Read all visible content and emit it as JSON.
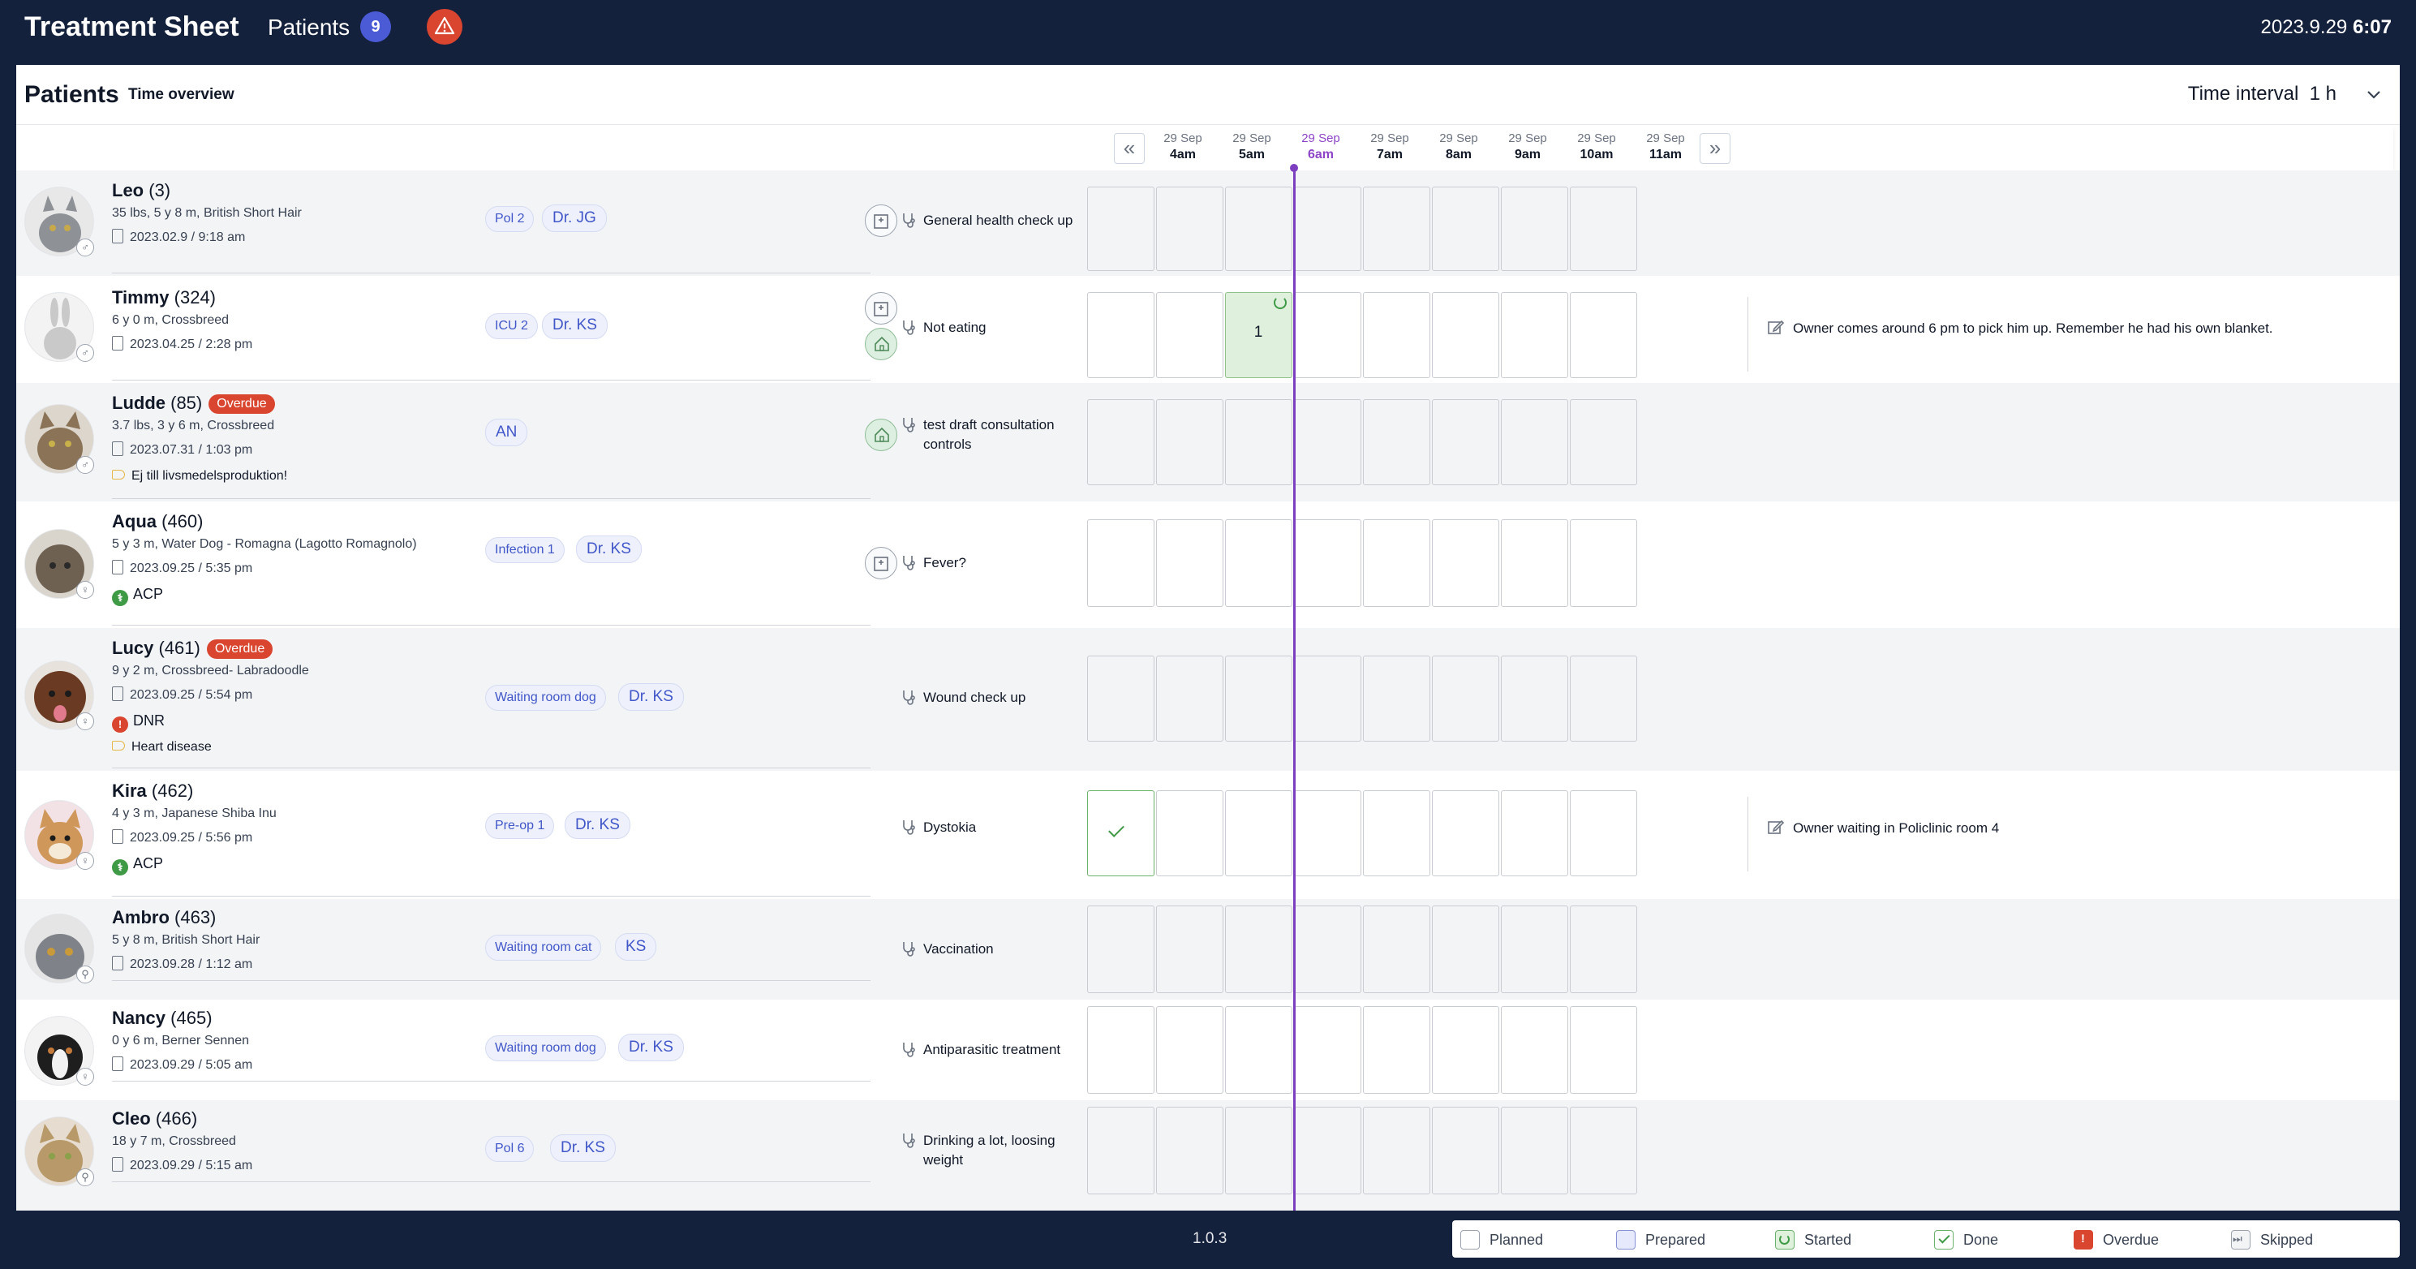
{
  "app": {
    "title": "Treatment Sheet",
    "nav_label": "Patients",
    "nav_count": "9",
    "alert_icon": "warning-triangle-icon",
    "date": "2023.9.29",
    "time": "6:07"
  },
  "panel": {
    "title": "Patients",
    "tab": "Time overview",
    "interval_label": "Time interval",
    "interval_value": "1 h"
  },
  "timeline": {
    "prev_label": "«",
    "next_label": "»",
    "slots": [
      {
        "date": "29 Sep",
        "hour": "4am"
      },
      {
        "date": "29 Sep",
        "hour": "5am"
      },
      {
        "date": "29 Sep",
        "hour": "6am",
        "current": true
      },
      {
        "date": "29 Sep",
        "hour": "7am"
      },
      {
        "date": "29 Sep",
        "hour": "8am"
      },
      {
        "date": "29 Sep",
        "hour": "9am"
      },
      {
        "date": "29 Sep",
        "hour": "10am"
      },
      {
        "date": "29 Sep",
        "hour": "11am"
      }
    ]
  },
  "patients": [
    {
      "name": "Leo",
      "id": "(3)",
      "info": "35 lbs, 5 y 8 m, British Short Hair",
      "date": "2023.02.9 / 9:18 am",
      "location": "Pol 2",
      "doctor": "Dr. JG",
      "task": "General health check up"
    },
    {
      "name": "Timmy",
      "id": "(324)",
      "info": "6 y 0 m, Crossbreed",
      "date": "2023.04.25 / 2:28 pm",
      "location": "ICU 2",
      "doctor": "Dr. KS",
      "task": "Not eating",
      "started_count": "1",
      "note": "Owner comes around 6 pm to pick him up. Remember he had his own blanket."
    },
    {
      "name": "Ludde",
      "id": "(85)",
      "overdue": "Overdue",
      "info": "3.7 lbs, 3 y 6 m, Crossbreed",
      "date": "2023.07.31 / 1:03 pm",
      "tag": "Ej till livsmedelsproduktion!",
      "doctor": "AN",
      "task_line1": "test draft consultation",
      "task_line2": "controls"
    },
    {
      "name": "Aqua",
      "id": "(460)",
      "info": "5 y 3 m, Water Dog - Romagna (Lagotto Romagnolo)",
      "date": "2023.09.25 / 5:35 pm",
      "flag": "ACP",
      "location": "Infection 1",
      "doctor": "Dr. KS",
      "task": "Fever?"
    },
    {
      "name": "Lucy",
      "id": "(461)",
      "overdue": "Overdue",
      "info": "9 y 2 m, Crossbreed- Labradoodle",
      "date": "2023.09.25 / 5:54 pm",
      "flag": "DNR",
      "tag": "Heart disease",
      "location": "Waiting room dog",
      "doctor": "Dr. KS",
      "task": "Wound check up"
    },
    {
      "name": "Kira",
      "id": "(462)",
      "info": "4 y 3 m, Japanese Shiba Inu",
      "date": "2023.09.25 / 5:56 pm",
      "flag": "ACP",
      "location": "Pre-op 1",
      "doctor": "Dr. KS",
      "task": "Dystokia",
      "note": "Owner waiting in Policlinic room 4"
    },
    {
      "name": "Ambro",
      "id": "(463)",
      "info": "5 y 8 m, British Short Hair",
      "date": "2023.09.28 / 1:12 am",
      "location": "Waiting room cat",
      "doctor": "KS",
      "task": "Vaccination"
    },
    {
      "name": "Nancy",
      "id": "(465)",
      "info": "0 y 6 m, Berner Sennen",
      "date": "2023.09.29 / 5:05 am",
      "location": "Waiting room dog",
      "doctor": "Dr. KS",
      "task": "Antiparasitic treatment"
    },
    {
      "name": "Cleo",
      "id": "(466)",
      "info": "18 y 7 m, Crossbreed",
      "date": "2023.09.29 / 5:15 am",
      "location": "Pol 6",
      "doctor": "Dr. KS",
      "task_line1": "Drinking a lot, loosing",
      "task_line2": "weight"
    }
  ],
  "colors": {
    "topbar": "#14213d",
    "accent_now": "#7b3fbf",
    "overdue": "#d9452f",
    "started": "#dff0dd",
    "chip_text": "#4056c9"
  },
  "footer": {
    "version": "1.0.3",
    "legend": {
      "planned": "Planned",
      "prepared": "Prepared",
      "started": "Started",
      "done": "Done",
      "overdue": "Overdue",
      "skipped": "Skipped"
    }
  }
}
